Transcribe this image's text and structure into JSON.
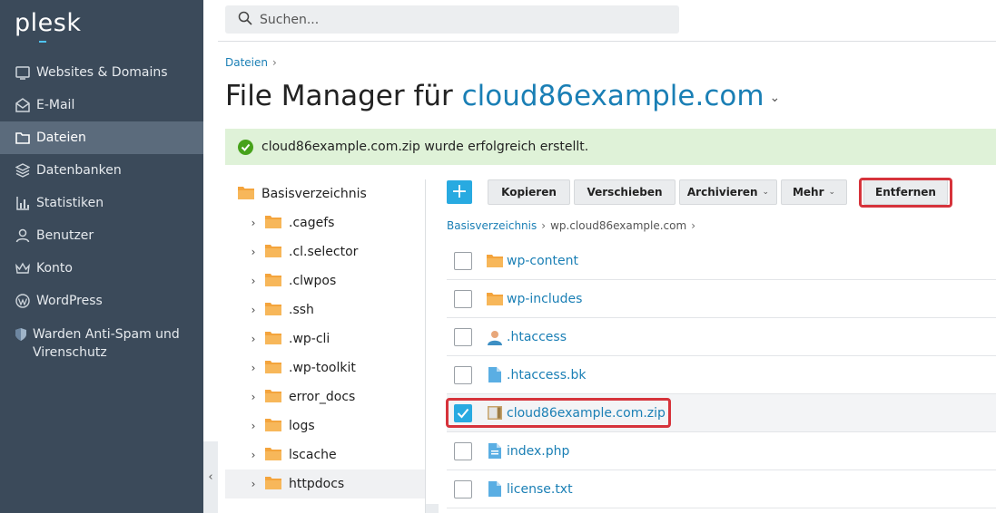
{
  "app": {
    "logo": "plesk"
  },
  "sidebar": {
    "items": [
      {
        "label": "Websites & Domains",
        "icon": "globe-icon"
      },
      {
        "label": "E-Mail",
        "icon": "mail-icon"
      },
      {
        "label": "Dateien",
        "icon": "folder-icon",
        "active": true
      },
      {
        "label": "Datenbanken",
        "icon": "database-icon"
      },
      {
        "label": "Statistiken",
        "icon": "chart-icon"
      },
      {
        "label": "Benutzer",
        "icon": "user-icon"
      },
      {
        "label": "Konto",
        "icon": "crown-icon"
      },
      {
        "label": "WordPress",
        "icon": "wordpress-icon"
      },
      {
        "label": "Warden Anti-Spam und Virenschutz",
        "icon": "shield-icon"
      }
    ],
    "collapse_glyph": "‹"
  },
  "search": {
    "placeholder": "Suchen..."
  },
  "breadcrumb": {
    "items": [
      "Dateien"
    ],
    "separator": "›"
  },
  "page": {
    "title_prefix": "File Manager für",
    "domain": "cloud86example.com",
    "caret": "⌄"
  },
  "alert": {
    "message": "cloud86example.com.zip wurde erfolgreich erstellt.",
    "type": "success"
  },
  "tree": {
    "root": "Basisverzeichnis",
    "items": [
      ".cagefs",
      ".cl.selector",
      ".clwpos",
      ".ssh",
      ".wp-cli",
      ".wp-toolkit",
      "error_docs",
      "logs",
      "lscache",
      "httpdocs"
    ],
    "selected": "httpdocs"
  },
  "toolbar": {
    "add_glyph": "+",
    "copy": "Kopieren",
    "move": "Verschieben",
    "archive": "Archivieren",
    "more": "Mehr",
    "remove": "Entfernen"
  },
  "path": {
    "root": "Basisverzeichnis",
    "current": "wp.cloud86example.com",
    "separator": "›"
  },
  "files": [
    {
      "name": "wp-content",
      "type": "folder",
      "checked": false
    },
    {
      "name": "wp-includes",
      "type": "folder",
      "checked": false
    },
    {
      "name": ".htaccess",
      "type": "user-file",
      "checked": false
    },
    {
      "name": ".htaccess.bk",
      "type": "document",
      "checked": false
    },
    {
      "name": "cloud86example.com.zip",
      "type": "archive",
      "checked": true
    },
    {
      "name": "index.php",
      "type": "code",
      "checked": false
    },
    {
      "name": "license.txt",
      "type": "document",
      "checked": false
    }
  ],
  "colors": {
    "sidebar": "#3b4a5a",
    "accent": "#1a7fb5",
    "highlight": "#d6333b",
    "success_bg": "#dff2d8",
    "folder": "#f4a43c"
  }
}
